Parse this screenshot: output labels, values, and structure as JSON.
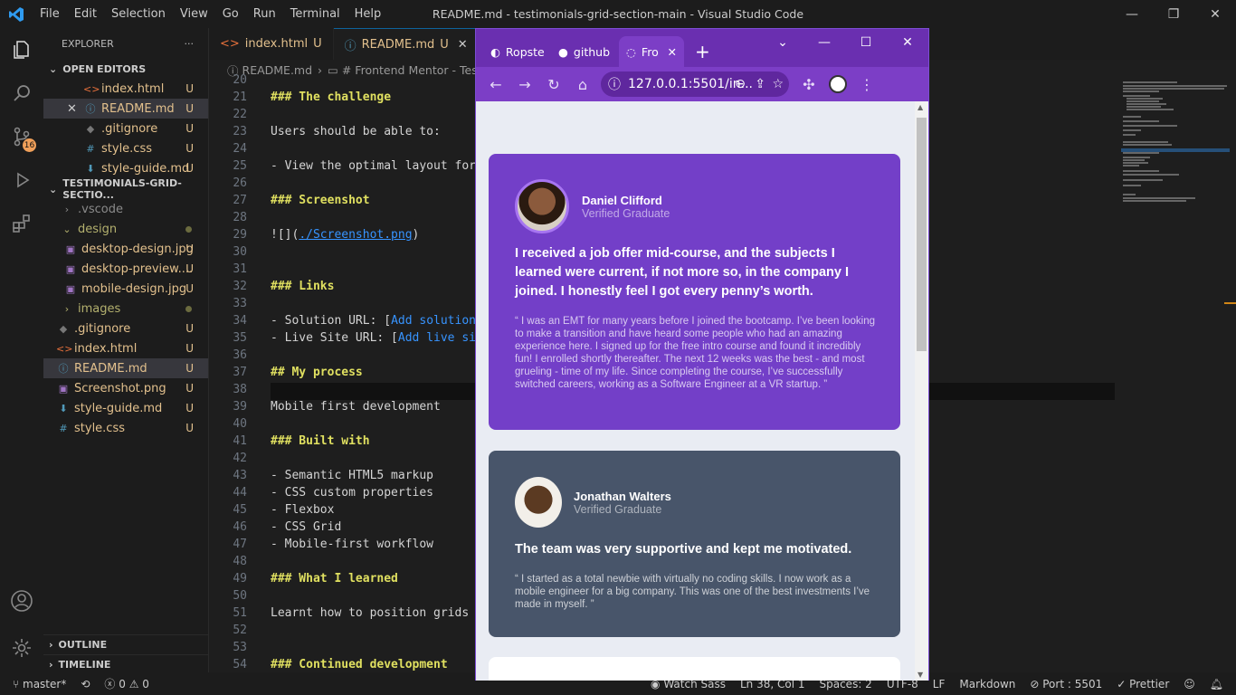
{
  "window": {
    "title": "README.md - testimonials-grid-section-main - Visual Studio Code"
  },
  "menu": [
    "File",
    "Edit",
    "Selection",
    "View",
    "Go",
    "Run",
    "Terminal",
    "Help"
  ],
  "activity": {
    "source_control_badge": "16"
  },
  "explorer": {
    "header": "EXPLORER",
    "open_editors_label": "OPEN EDITORS",
    "open_editors": [
      {
        "name": "index.html",
        "status": "U"
      },
      {
        "name": "README.md",
        "status": "U"
      },
      {
        "name": ".gitignore",
        "status": "U"
      },
      {
        "name": "style.css",
        "status": "U"
      },
      {
        "name": "style-guide.md",
        "status": "U"
      }
    ],
    "project_label": "TESTIMONIALS-GRID-SECTIO...",
    "tree": [
      {
        "name": ".vscode",
        "status": ""
      },
      {
        "name": "design",
        "status": ""
      },
      {
        "name": "desktop-design.jpg",
        "status": "U"
      },
      {
        "name": "desktop-preview....",
        "status": "U"
      },
      {
        "name": "mobile-design.jpg",
        "status": "U"
      },
      {
        "name": "images",
        "status": ""
      },
      {
        "name": ".gitignore",
        "status": "U"
      },
      {
        "name": "index.html",
        "status": "U"
      },
      {
        "name": "README.md",
        "status": "U"
      },
      {
        "name": "Screenshot.png",
        "status": "U"
      },
      {
        "name": "style-guide.md",
        "status": "U"
      },
      {
        "name": "style.css",
        "status": "U"
      }
    ],
    "outline_label": "OUTLINE",
    "timeline_label": "TIMELINE"
  },
  "editor": {
    "tabs": [
      {
        "name": "index.html",
        "status": "U"
      },
      {
        "name": "README.md",
        "status": "U"
      }
    ],
    "breadcrumb": [
      "README.md",
      "# Frontend Mentor - Testi"
    ],
    "lines": [
      {
        "n": "20",
        "t": ""
      },
      {
        "n": "21",
        "t": "### The challenge"
      },
      {
        "n": "22",
        "t": ""
      },
      {
        "n": "23",
        "t": "Users should be able to:"
      },
      {
        "n": "24",
        "t": ""
      },
      {
        "n": "25",
        "t": "- View the optimal layout for"
      },
      {
        "n": "26",
        "t": ""
      },
      {
        "n": "27",
        "t": "### Screenshot"
      },
      {
        "n": "28",
        "t": ""
      },
      {
        "n": "29",
        "t": "![](./Screenshot.png)"
      },
      {
        "n": "30",
        "t": ""
      },
      {
        "n": "31",
        "t": ""
      },
      {
        "n": "32",
        "t": "### Links"
      },
      {
        "n": "33",
        "t": ""
      },
      {
        "n": "34",
        "t": "- Solution URL: [Add solution"
      },
      {
        "n": "35",
        "t": "- Live Site URL: [Add live sit"
      },
      {
        "n": "36",
        "t": ""
      },
      {
        "n": "37",
        "t": "## My process"
      },
      {
        "n": "38",
        "t": ""
      },
      {
        "n": "39",
        "t": "Mobile first development"
      },
      {
        "n": "40",
        "t": ""
      },
      {
        "n": "41",
        "t": "### Built with"
      },
      {
        "n": "42",
        "t": ""
      },
      {
        "n": "43",
        "t": "- Semantic HTML5 markup"
      },
      {
        "n": "44",
        "t": "- CSS custom properties"
      },
      {
        "n": "45",
        "t": "- Flexbox"
      },
      {
        "n": "46",
        "t": "- CSS Grid"
      },
      {
        "n": "47",
        "t": "- Mobile-first workflow"
      },
      {
        "n": "48",
        "t": ""
      },
      {
        "n": "49",
        "t": "### What I learned"
      },
      {
        "n": "50",
        "t": ""
      },
      {
        "n": "51",
        "t": "Learnt how to position grids t"
      },
      {
        "n": "52",
        "t": ""
      },
      {
        "n": "53",
        "t": ""
      },
      {
        "n": "54",
        "t": "### Continued development"
      }
    ]
  },
  "status": {
    "branch": "master*",
    "errors": "0",
    "warnings": "0",
    "watch_sass": "Watch Sass",
    "position": "Ln 38, Col 1",
    "spaces": "Spaces: 2",
    "encoding": "UTF-8",
    "eol": "LF",
    "language": "Markdown",
    "port": "Port : 5501",
    "prettier": "Prettier"
  },
  "browser": {
    "tabs": [
      {
        "label": "Ropste"
      },
      {
        "label": "github"
      },
      {
        "label": "Fro"
      }
    ],
    "url": "127.0.0.1:5501/in...",
    "testimonials": [
      {
        "name": "Daniel Clifford",
        "role": "Verified Graduate",
        "headline": "I received a job offer mid-course, and the subjects I learned were current, if not more so, in the company I joined. I honestly feel I got every penny’s worth.",
        "quote": "“ I was an EMT for many years before I joined the bootcamp. I’ve been looking to make a transition and have heard some people who had an amazing experience here. I signed up for the free intro course and found it incredibly fun! I enrolled shortly thereafter. The next 12 weeks was the best - and most grueling - time of my life. Since completing the course, I’ve successfully switched careers, working as a Software Engineer at a VR startup. ”",
        "color": "#733fc8"
      },
      {
        "name": "Jonathan Walters",
        "role": "Verified Graduate",
        "headline": "The team was very supportive and kept me motivated.",
        "quote": "“ I started as a total newbie with virtually no coding skills. I now work as a mobile engineer for a big company. This was one of the best investments I’ve made in myself. ”",
        "color": "#48556a"
      }
    ]
  },
  "colors": {
    "accent": "#0e639c",
    "chrome": "#6a2fb0",
    "modified": "#e2c08d"
  }
}
